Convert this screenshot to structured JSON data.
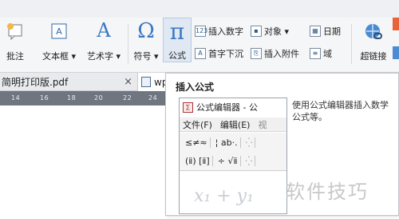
{
  "ribbon": {
    "buttons": [
      {
        "label": "批注",
        "icon": "comment-icon"
      },
      {
        "label": "文本框 ▾",
        "icon": "textbox-icon"
      },
      {
        "label": "艺术字 ▾",
        "icon": "wordart-icon"
      },
      {
        "label": "符号 ▾",
        "icon": "omega-symbol-icon"
      },
      {
        "label": "公式",
        "icon": "pi-formula-icon"
      },
      {
        "label": "超链接",
        "icon": "hyperlink-icon"
      }
    ],
    "small_buttons": [
      {
        "label": "插入数字",
        "icon": "number-icon"
      },
      {
        "label": "对象 ▾",
        "icon": "object-icon"
      },
      {
        "label": "日期",
        "icon": "calendar-icon"
      },
      {
        "label": "首字下沉",
        "icon": "dropcap-icon"
      },
      {
        "label": "插入附件",
        "icon": "attachment-icon"
      },
      {
        "label": "域",
        "icon": "field-icon"
      }
    ],
    "icon_glyphs": {
      "omega": "Ω",
      "pi": "π",
      "A": "A"
    }
  },
  "tabs": [
    {
      "label": "简明打印版.pdf",
      "close": "×"
    },
    {
      "label": "wp",
      "active": true
    }
  ],
  "ruler": {
    "marks": [
      "14",
      "16",
      "18",
      "20",
      "22",
      "24"
    ]
  },
  "tooltip": {
    "title": "插入公式",
    "description": "使用公式编辑器插入数学公式等。",
    "preview": {
      "window_title": "公式编辑器 - 公",
      "menu": [
        "文件(F)",
        "编辑(E)",
        "视"
      ],
      "toolbar_row1": [
        "≤≠≈",
        "¦ ab·.",
        "⁛"
      ],
      "toolbar_row2": [
        "(ⅱ) [ⅱ]",
        "÷ √ⅱ",
        "⁛"
      ],
      "expression": "x₁ + y₁"
    }
  },
  "watermark": "软件技巧"
}
